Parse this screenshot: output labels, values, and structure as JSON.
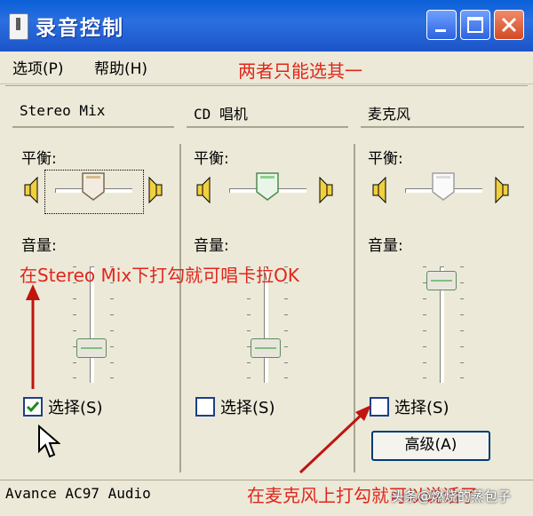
{
  "window": {
    "title": "录音控制"
  },
  "titlebar_buttons": {
    "minimize": "minimize-icon",
    "maximize": "maximize-icon",
    "close": "close-icon"
  },
  "menu": {
    "items": [
      {
        "label": "选项(P)"
      },
      {
        "label": "帮助(H)"
      }
    ]
  },
  "annotations": {
    "top": "两者只能选其一",
    "middle": "在Stereo Mix下打勾就可唱卡拉OK",
    "bottom": "在麦克风上打勾就可以说话了"
  },
  "columns": [
    {
      "name": "Stereo Mix",
      "balance_label": "平衡:",
      "volume_label": "音量:",
      "select_label": "选择(S)",
      "selected": true,
      "volume_level": 0.25
    },
    {
      "name": "CD 唱机",
      "balance_label": "平衡:",
      "volume_label": "音量:",
      "select_label": "选择(S)",
      "selected": false,
      "volume_level": 0.25
    },
    {
      "name": "麦克风",
      "balance_label": "平衡:",
      "volume_label": "音量:",
      "select_label": "选择(S)",
      "selected": false,
      "volume_level": 0.95,
      "advanced_label": "高级(A)"
    }
  ],
  "status": {
    "text": "Avance AC97 Audio"
  },
  "watermark": "头条@燃烧的蒸包子",
  "colors": {
    "titlebar": "#2a6fe0",
    "annotation": "#e0261b",
    "window_bg": "#ece9d8"
  }
}
